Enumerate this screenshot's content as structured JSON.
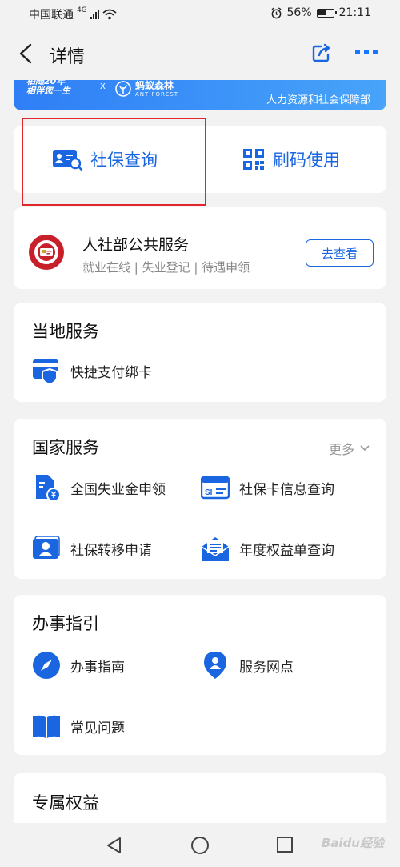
{
  "status_bar": {
    "carrier": "中国联通",
    "network": "4G",
    "battery": "56%",
    "time": "21:11"
  },
  "nav": {
    "title": "详情"
  },
  "banner": {
    "slogan_line1": "相随20年",
    "slogan_line2": "相伴您一生",
    "partner_x": "X",
    "partner_name": "蚂蚁森林",
    "partner_sub": "ANT FOREST",
    "org": "人力资源和社会保障部"
  },
  "quick_actions": [
    {
      "label": "社保查询",
      "icon": "id-card-search-icon"
    },
    {
      "label": "刷码使用",
      "icon": "qr-code-icon"
    }
  ],
  "public_service": {
    "title": "人社部公共服务",
    "subtitle": "就业在线 | 失业登记 | 待遇申领",
    "button": "去查看",
    "logo_text": "SOCIAL SECURITY CARD"
  },
  "local_services": {
    "title": "当地服务",
    "items": [
      {
        "label": "快捷支付绑卡",
        "icon": "card-shield-icon"
      }
    ]
  },
  "national_services": {
    "title": "国家服务",
    "more": "更多",
    "items": [
      {
        "label": "全国失业金申领",
        "icon": "document-yuan-icon"
      },
      {
        "label": "社保卡信息查询",
        "icon": "si-card-icon"
      },
      {
        "label": "社保转移申请",
        "icon": "person-card-icon"
      },
      {
        "label": "年度权益单查询",
        "icon": "envelope-document-icon"
      }
    ]
  },
  "guide": {
    "title": "办事指引",
    "items": [
      {
        "label": "办事指南",
        "icon": "compass-icon"
      },
      {
        "label": "服务网点",
        "icon": "location-pin-icon"
      },
      {
        "label": "常见问题",
        "icon": "book-icon"
      }
    ]
  },
  "exclusive": {
    "title": "专属权益"
  },
  "watermark": "Baidu经验",
  "colors": {
    "accent": "#1a66e0",
    "highlight_box": "#e0262b",
    "background": "#f2f2f2"
  }
}
